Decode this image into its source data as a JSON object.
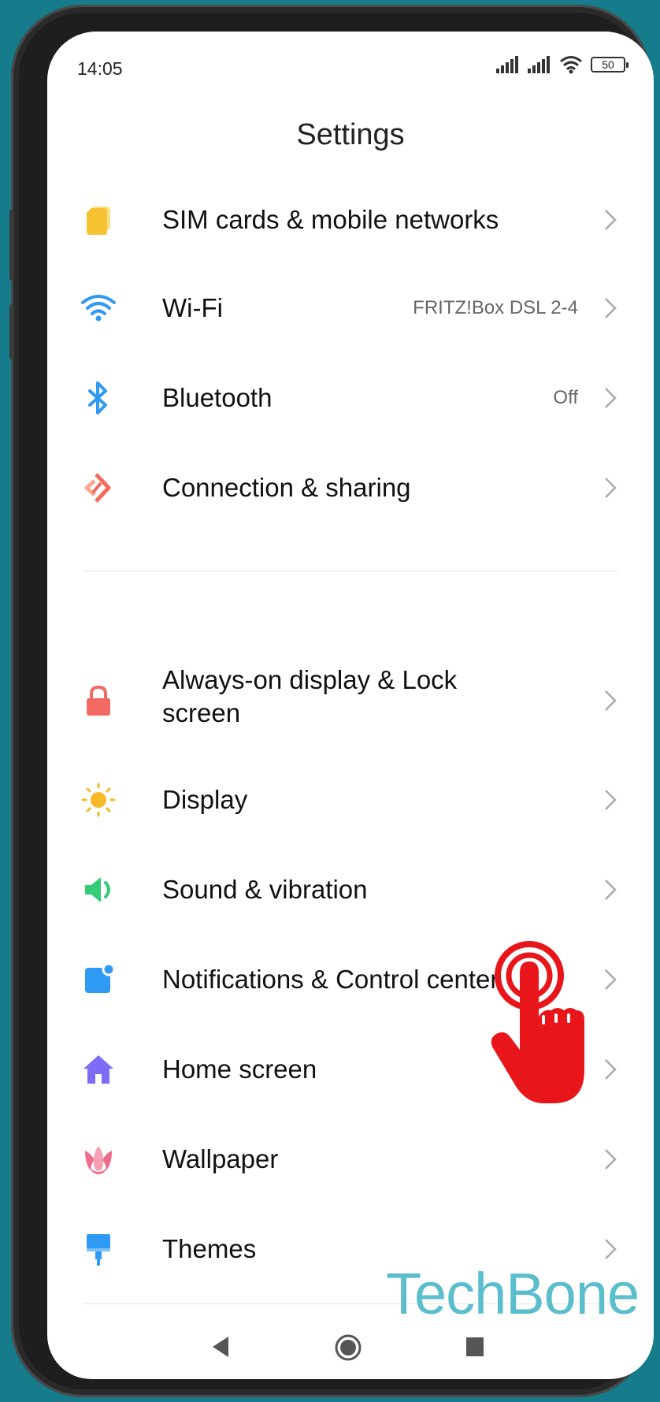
{
  "status_bar": {
    "time": "14:05",
    "battery": "50"
  },
  "header": {
    "title": "Settings"
  },
  "settings": [
    {
      "label": "SIM cards & mobile networks",
      "value": "",
      "icon": "sim-card-icon",
      "color": "#f7c232"
    },
    {
      "label": "Wi-Fi",
      "value": "FRITZ!Box DSL 2-4",
      "icon": "wifi-icon",
      "color": "#2f9af3"
    },
    {
      "label": "Bluetooth",
      "value": "Off",
      "icon": "bluetooth-icon",
      "color": "#2f9af3"
    },
    {
      "label": "Connection & sharing",
      "value": "",
      "icon": "connection-sharing-icon",
      "color": "#f36b5a"
    },
    {
      "label": "Always-on display & Lock screen",
      "value": "",
      "icon": "lock-icon",
      "color": "#f26a63"
    },
    {
      "label": "Display",
      "value": "",
      "icon": "sun-icon",
      "color": "#f7b928"
    },
    {
      "label": "Sound & vibration",
      "value": "",
      "icon": "speaker-icon",
      "color": "#33cc77"
    },
    {
      "label": "Notifications & Control center",
      "value": "",
      "icon": "notification-icon",
      "color": "#2f9af3"
    },
    {
      "label": "Home screen",
      "value": "",
      "icon": "home-icon",
      "color": "#7d6cf5"
    },
    {
      "label": "Wallpaper",
      "value": "",
      "icon": "tulip-icon",
      "color": "#f26a8a"
    },
    {
      "label": "Themes",
      "value": "",
      "icon": "paintbrush-icon",
      "color": "#2f9af3"
    }
  ],
  "watermark": "TechBone",
  "colors": {
    "background": "#167b8a",
    "tap_indicator": "#e8161b",
    "watermark": "#5bbecc"
  }
}
